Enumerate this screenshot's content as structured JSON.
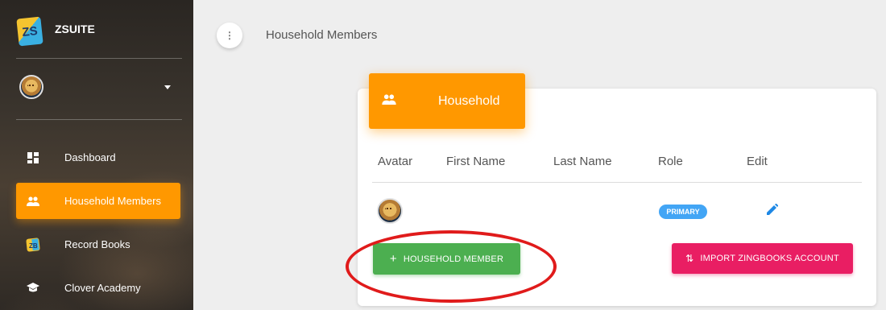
{
  "brand": {
    "logo_text": "ZS",
    "title": "ZSUITE"
  },
  "sidebar": {
    "items": [
      {
        "label": "Dashboard",
        "icon": "dashboard-icon",
        "active": false
      },
      {
        "label": "Household Members",
        "icon": "people-icon",
        "active": true
      },
      {
        "label": "Record Books",
        "icon": "record-books-icon",
        "active": false
      },
      {
        "label": "Clover Academy",
        "icon": "school-icon",
        "active": false
      }
    ]
  },
  "topbar": {
    "menu_glyph": "⋮",
    "page_title": "Household Members"
  },
  "card": {
    "header_title": "Household",
    "columns": [
      "Avatar",
      "First Name",
      "Last Name",
      "Role",
      "Edit"
    ],
    "rows": [
      {
        "first_name": "",
        "last_name": "",
        "role": "PRIMARY"
      }
    ],
    "add_button_label": "HOUSEHOLD MEMBER",
    "import_button_label": "IMPORT ZINGBOOKS ACCOUNT"
  },
  "colors": {
    "accent": "#ff9800",
    "add_button": "#4caf50",
    "import_button": "#e91e63",
    "badge": "#42a5f5",
    "annotation": "#e01b1b"
  }
}
